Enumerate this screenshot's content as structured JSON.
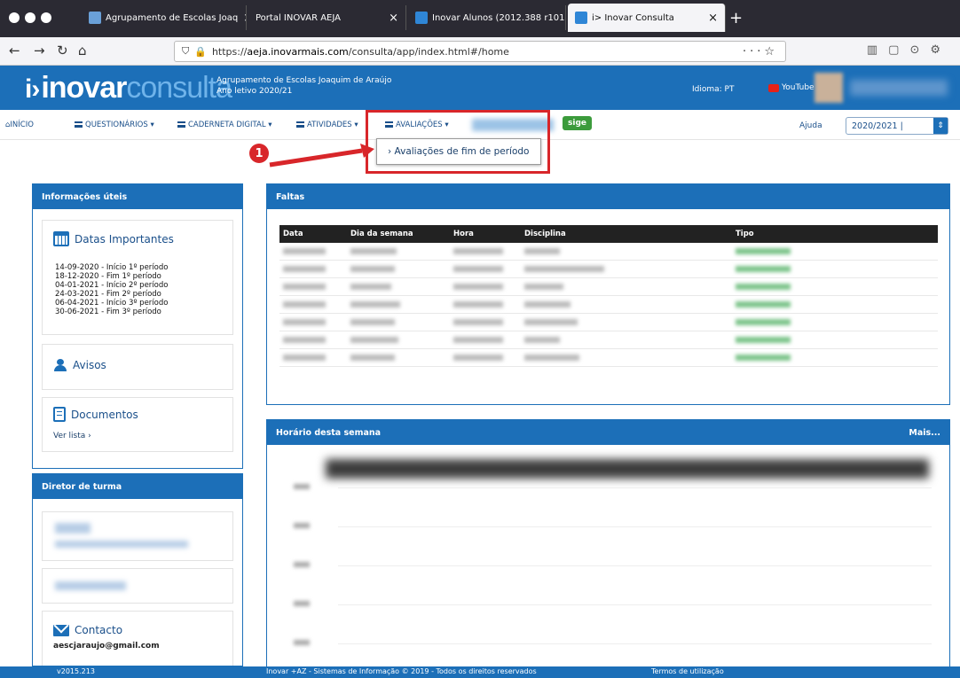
{
  "browser": {
    "tabs": [
      {
        "title": "Agrupamento de Escolas Joaq",
        "active": false
      },
      {
        "title": "Portal INOVAR AEJA",
        "active": false
      },
      {
        "title": "Inovar Alunos (2012.388 r101",
        "active": false
      },
      {
        "title": "i> Inovar Consulta",
        "active": true
      }
    ],
    "url_prefix": "https://",
    "url_domain": "aeja.inovarmais.com",
    "url_path": "/consulta/app/index.html#/home"
  },
  "header": {
    "logo_main": "inovar",
    "logo_sub": "consulta",
    "school_name": "Agrupamento de Escolas Joaquim de Araújo",
    "school_year": "Ano letivo 2020/21",
    "language": "Idioma: PT",
    "youtube": "YouTube"
  },
  "menu": {
    "inicio": "INÍCIO",
    "questionarios": "QUESTIONÁRIOS ▾",
    "caderneta": "CADERNETA DIGITAL ▾",
    "atividades": "ATIVIDADES ▾",
    "avaliacoes": "AVALIAÇÕES ▾",
    "sige": "sige",
    "ajuda": "Ajuda",
    "year": "2020/2021 |",
    "dropdown_item": "› Avaliações de fim de período",
    "annotation": "1"
  },
  "info": {
    "title": "Informações úteis",
    "dates_title": "Datas Importantes",
    "dates": [
      "14-09-2020 - Início 1º período",
      "18-12-2020 - Fim 1º período",
      "04-01-2021 - Início 2º período",
      "24-03-2021 - Fim 2º período",
      "06-04-2021 - Início 3º período",
      "30-06-2021 - Fim 3º período"
    ],
    "avisos": "Avisos",
    "documentos": "Documentos",
    "ver_lista": "Ver lista ›"
  },
  "diretor": {
    "title": "Diretor de turma",
    "contacto": "Contacto",
    "email": "aescjaraujo@gmail.com"
  },
  "faltas": {
    "title": "Faltas",
    "columns": [
      "Data",
      "Dia da semana",
      "Hora",
      "Disciplina",
      "Tipo"
    ]
  },
  "horario": {
    "title": "Horário desta semana",
    "more": "Mais..."
  },
  "footer": {
    "version": "v2015.213",
    "copyright": "Inovar +AZ - Sistemas de Informação © 2019 - Todos os direitos reservados",
    "terms": "Termos de utilização"
  },
  "colors": {
    "brand_blue": "#1c6fb8",
    "highlight_red": "#d8262a",
    "sige_green": "#3c9b3c"
  }
}
